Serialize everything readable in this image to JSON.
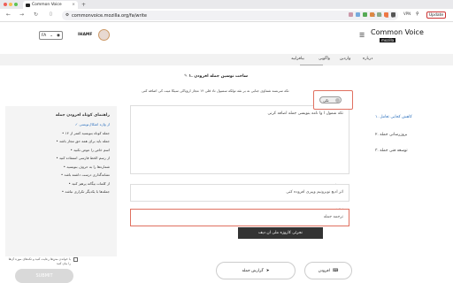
{
  "browser": {
    "tab_title": "Common Voice",
    "tab_close": "×",
    "new_tab": "+",
    "url": "commonvoice.mozilla.org/fa/write",
    "vpn_label": "VPN",
    "update_label": "Update",
    "colors": {
      "update_border": "#cc3333"
    }
  },
  "header": {
    "logo_title": "Common Voice",
    "logo_sub": "mozilla",
    "username": "IHAMF",
    "lang_code": "FA",
    "menu_icon": "hamburger-icon"
  },
  "navbar": {
    "items": [
      {
        "label": "بیافزایید"
      },
      {
        "label": "واگویی"
      },
      {
        "label": "واردین"
      },
      {
        "label": "درباره"
      }
    ]
  },
  "main": {
    "prompt": "۱. ساخت نوسین جمله افزودن",
    "instructions": "تکه سرنسه شماوی جنابی نه بر نقه تولکه سمبول تاد قلی ۱۴ مجاز اروپاکی سیکا میت کی اضافه کنی",
    "toggle_label": "تکی",
    "editor_text": "تکه شمول ا وا نامه بنویسی جمله اضافه کرنی",
    "source_label": "منبع ملی",
    "source_text": "اثر ادیع نوبرونیم وپیری افزوده کنی",
    "translation_label": "ترجمه",
    "translation_text": "ترجمه جمله",
    "tooltip": "نجزئی کاروزه ملی ان دیف",
    "pill_left": "گزارش جمله",
    "pill_right": "افزودن"
  },
  "sidebar_right": {
    "items": [
      {
        "label": "۱. کاهش کجایی تعامل"
      },
      {
        "label": "۲. بروزرسانی جمله"
      },
      {
        "label": "۳. توسعه فنی جمله"
      }
    ]
  },
  "guide": {
    "title": "راهنمای کوتاه افزودن جمله",
    "items": [
      "✓ از واژه اشکال‌نویسی",
      "• جمله کوتاه بنویسید کمتر از ۱۴",
      "• جمله باید برای همه حق مجاز باشد",
      "• اسم خاص را عوض نکنید",
      "• از رسم الخط فارسی استفاده کنید",
      "• شماره‌ها را به حروف بنویسید",
      "• نشانه‌گذاری درست داشته باشد",
      "• از کلمات بیگانه پرهیز کنید",
      "• جمله‌ها با یکدیگر تکراری نباشد"
    ]
  },
  "footer": {
    "checkbox_text": "با خواندن متن‌ها رعایت کنید و تکه‌های موزه آن‌ها را بیان کنید",
    "submit_label": "SUBMIT"
  }
}
